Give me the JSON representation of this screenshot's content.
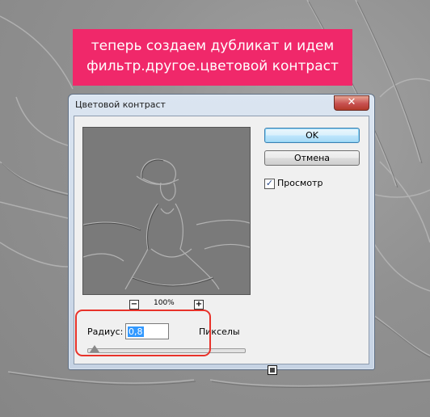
{
  "banner": {
    "line1": "теперь создаем дубликат и идем",
    "line2": "фильтр.другое.цветовой контраст"
  },
  "dialog": {
    "title": "Цветовой контраст",
    "close_label": "✕",
    "ok_label": "OK",
    "cancel_label": "Отмена",
    "preview_checkbox": {
      "label": "Просмотр",
      "checked": true,
      "mark": "✓"
    },
    "zoom": {
      "minus_label": "−",
      "plus_label": "+",
      "level": "100%"
    },
    "radius": {
      "label": "Радиус:",
      "value": "0,8",
      "unit": "Пикселы"
    }
  },
  "colors": {
    "banner_bg": "#f0286a",
    "highlight_border": "#e8322a",
    "ok_button": "#bee6fd"
  },
  "icons": [
    "zoom-out-icon",
    "zoom-in-icon",
    "close-icon",
    "checkmark-icon",
    "slider-thumb-icon",
    "resize-handle-icon"
  ]
}
